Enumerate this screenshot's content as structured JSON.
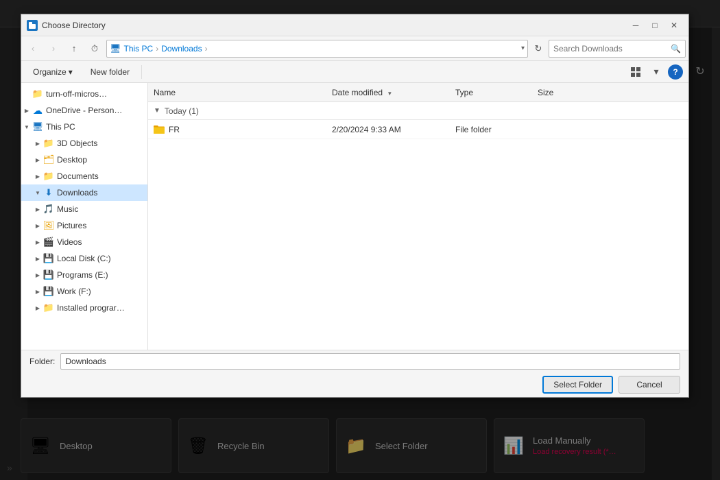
{
  "app": {
    "title": "Choose Directory",
    "title_icon": "folder"
  },
  "dialog": {
    "title": "Choose Directory"
  },
  "nav": {
    "back_label": "←",
    "forward_label": "→",
    "up_label": "↑",
    "recent_label": "▾",
    "address": {
      "parts": [
        "This PC",
        "Downloads"
      ],
      "separators": [
        ">",
        ">"
      ]
    },
    "search_placeholder": "Search Downloads"
  },
  "ribbon": {
    "organize_label": "Organize",
    "organize_arrow": "▾",
    "new_folder_label": "New folder",
    "view_label": "⊞",
    "view_arrow": "▾",
    "help_label": "?"
  },
  "tree": {
    "items": [
      {
        "id": "turn-off",
        "label": "turn-off-micros…",
        "icon": "folder",
        "level": 0,
        "expanded": false,
        "hasExpand": false
      },
      {
        "id": "onedrive",
        "label": "OneDrive - Person…",
        "icon": "cloud",
        "level": 0,
        "expanded": false,
        "hasExpand": true
      },
      {
        "id": "thispc",
        "label": "This PC",
        "icon": "computer",
        "level": 0,
        "expanded": true,
        "hasExpand": true
      },
      {
        "id": "3dobjects",
        "label": "3D Objects",
        "icon": "folder",
        "level": 1,
        "expanded": false,
        "hasExpand": true
      },
      {
        "id": "desktop",
        "label": "Desktop",
        "icon": "folder_desktop",
        "level": 1,
        "expanded": false,
        "hasExpand": true
      },
      {
        "id": "documents",
        "label": "Documents",
        "icon": "folder",
        "level": 1,
        "expanded": false,
        "hasExpand": true
      },
      {
        "id": "downloads",
        "label": "Downloads",
        "icon": "folder_downloads",
        "level": 1,
        "expanded": true,
        "hasExpand": true,
        "selected": true
      },
      {
        "id": "music",
        "label": "Music",
        "icon": "folder_music",
        "level": 1,
        "expanded": false,
        "hasExpand": true
      },
      {
        "id": "pictures",
        "label": "Pictures",
        "icon": "folder_pictures",
        "level": 1,
        "expanded": false,
        "hasExpand": true
      },
      {
        "id": "videos",
        "label": "Videos",
        "icon": "folder_video",
        "level": 1,
        "expanded": false,
        "hasExpand": true
      },
      {
        "id": "localdisk",
        "label": "Local Disk (C:)",
        "icon": "drive",
        "level": 1,
        "expanded": false,
        "hasExpand": true
      },
      {
        "id": "programs",
        "label": "Programs (E:)",
        "icon": "drive",
        "level": 1,
        "expanded": false,
        "hasExpand": true
      },
      {
        "id": "work",
        "label": "Work (F:)",
        "icon": "drive",
        "level": 1,
        "expanded": false,
        "hasExpand": true
      },
      {
        "id": "installed",
        "label": "Installed prograr…",
        "icon": "folder",
        "level": 1,
        "expanded": false,
        "hasExpand": true
      }
    ]
  },
  "file_list": {
    "columns": [
      "Name",
      "Date modified",
      "Type",
      "Size"
    ],
    "sort_col": "Date modified",
    "sort_dir": "desc",
    "groups": [
      {
        "label": "Today (1)",
        "expanded": true,
        "files": [
          {
            "name": "FR",
            "date": "2/20/2024 9:33 AM",
            "type": "File folder",
            "size": ""
          }
        ]
      }
    ]
  },
  "bottom": {
    "folder_label": "Folder:",
    "folder_value": "Downloads",
    "select_btn": "Select Folder",
    "cancel_btn": "Cancel"
  },
  "bg_items": [
    {
      "id": "desktop",
      "icon": "🖥",
      "label": "Desktop",
      "sub": ""
    },
    {
      "id": "recycle",
      "icon": "🗑",
      "label": "Recycle Bin",
      "sub": ""
    },
    {
      "id": "selectfolder",
      "icon": "📁",
      "label": "Select Folder",
      "sub": ""
    },
    {
      "id": "loadmanually",
      "icon": "📊",
      "label": "Load Manually",
      "sub": "Load recovery result (*…"
    }
  ],
  "bg_left_icon": "»"
}
